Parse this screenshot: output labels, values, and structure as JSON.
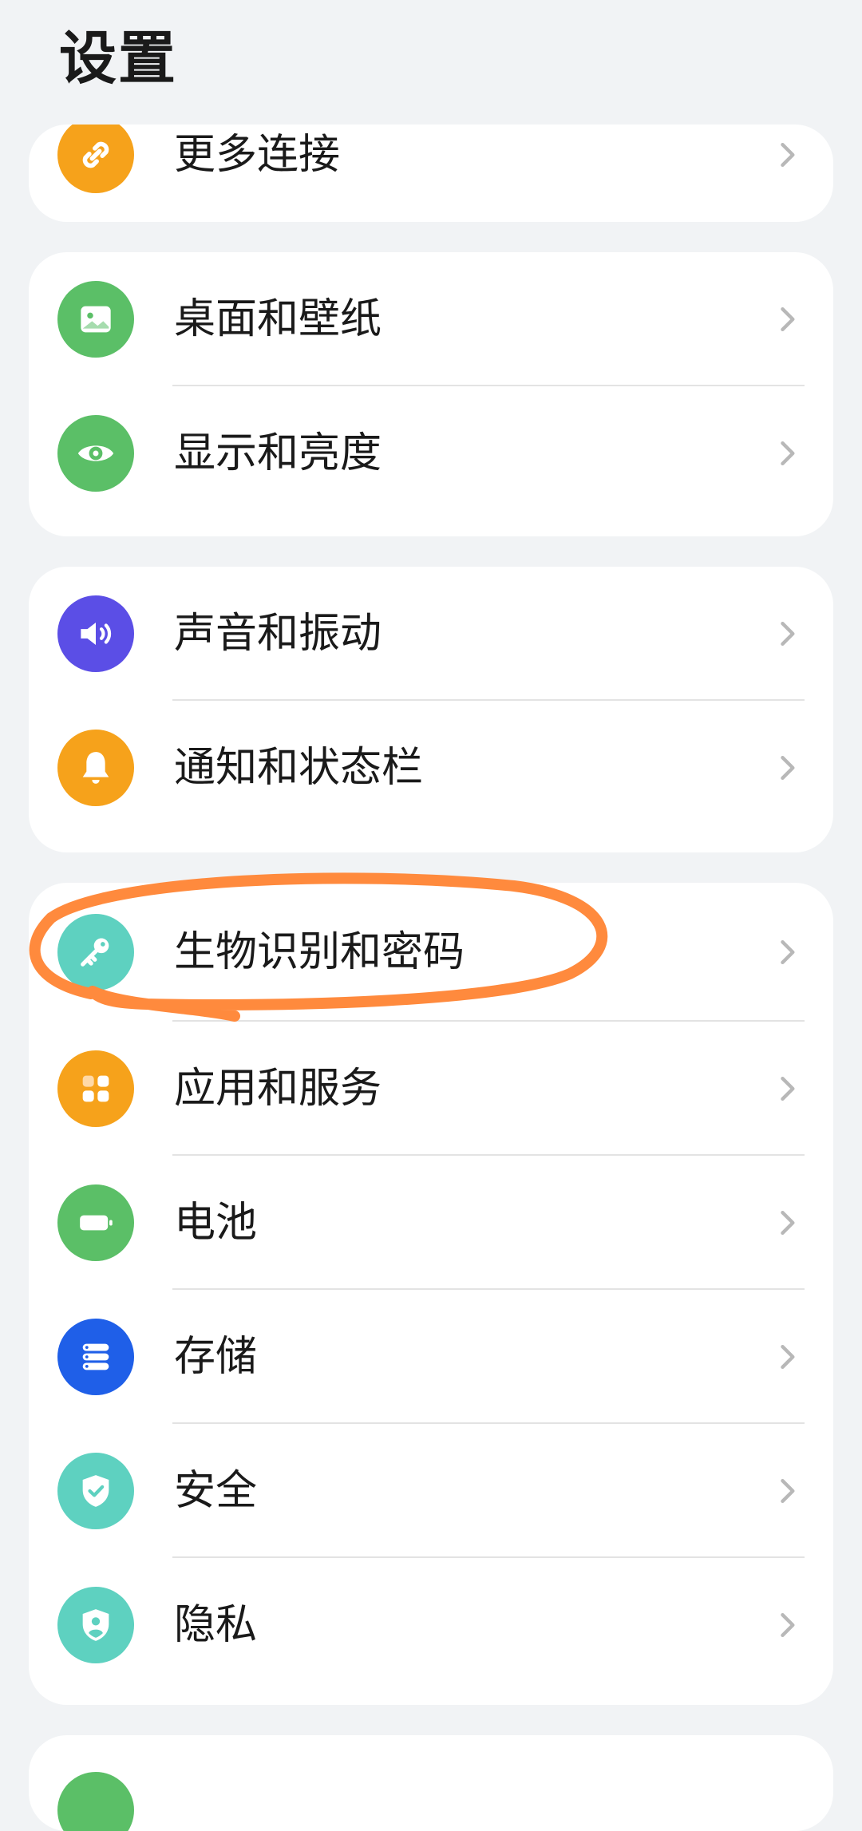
{
  "page": {
    "title": "设置"
  },
  "colors": {
    "orange": "#f6a21b",
    "green": "#5bbf67",
    "purple": "#5b4ee6",
    "teal": "#5ed1c0",
    "blue": "#1f5fe8",
    "annotation": "#ff8a3d"
  },
  "groups": [
    {
      "items": [
        {
          "label": "更多连接",
          "icon": "link-icon"
        }
      ]
    },
    {
      "items": [
        {
          "label": "桌面和壁纸",
          "icon": "wallpaper-icon"
        },
        {
          "label": "显示和亮度",
          "icon": "eye-icon"
        }
      ]
    },
    {
      "items": [
        {
          "label": "声音和振动",
          "icon": "speaker-icon"
        },
        {
          "label": "通知和状态栏",
          "icon": "bell-icon"
        }
      ]
    },
    {
      "items": [
        {
          "label": "生物识别和密码",
          "icon": "key-icon"
        },
        {
          "label": "应用和服务",
          "icon": "apps-grid-icon"
        },
        {
          "label": "电池",
          "icon": "battery-icon"
        },
        {
          "label": "存储",
          "icon": "storage-icon"
        },
        {
          "label": "安全",
          "icon": "shield-check-icon"
        },
        {
          "label": "隐私",
          "icon": "privacy-shield-icon"
        }
      ]
    }
  ]
}
